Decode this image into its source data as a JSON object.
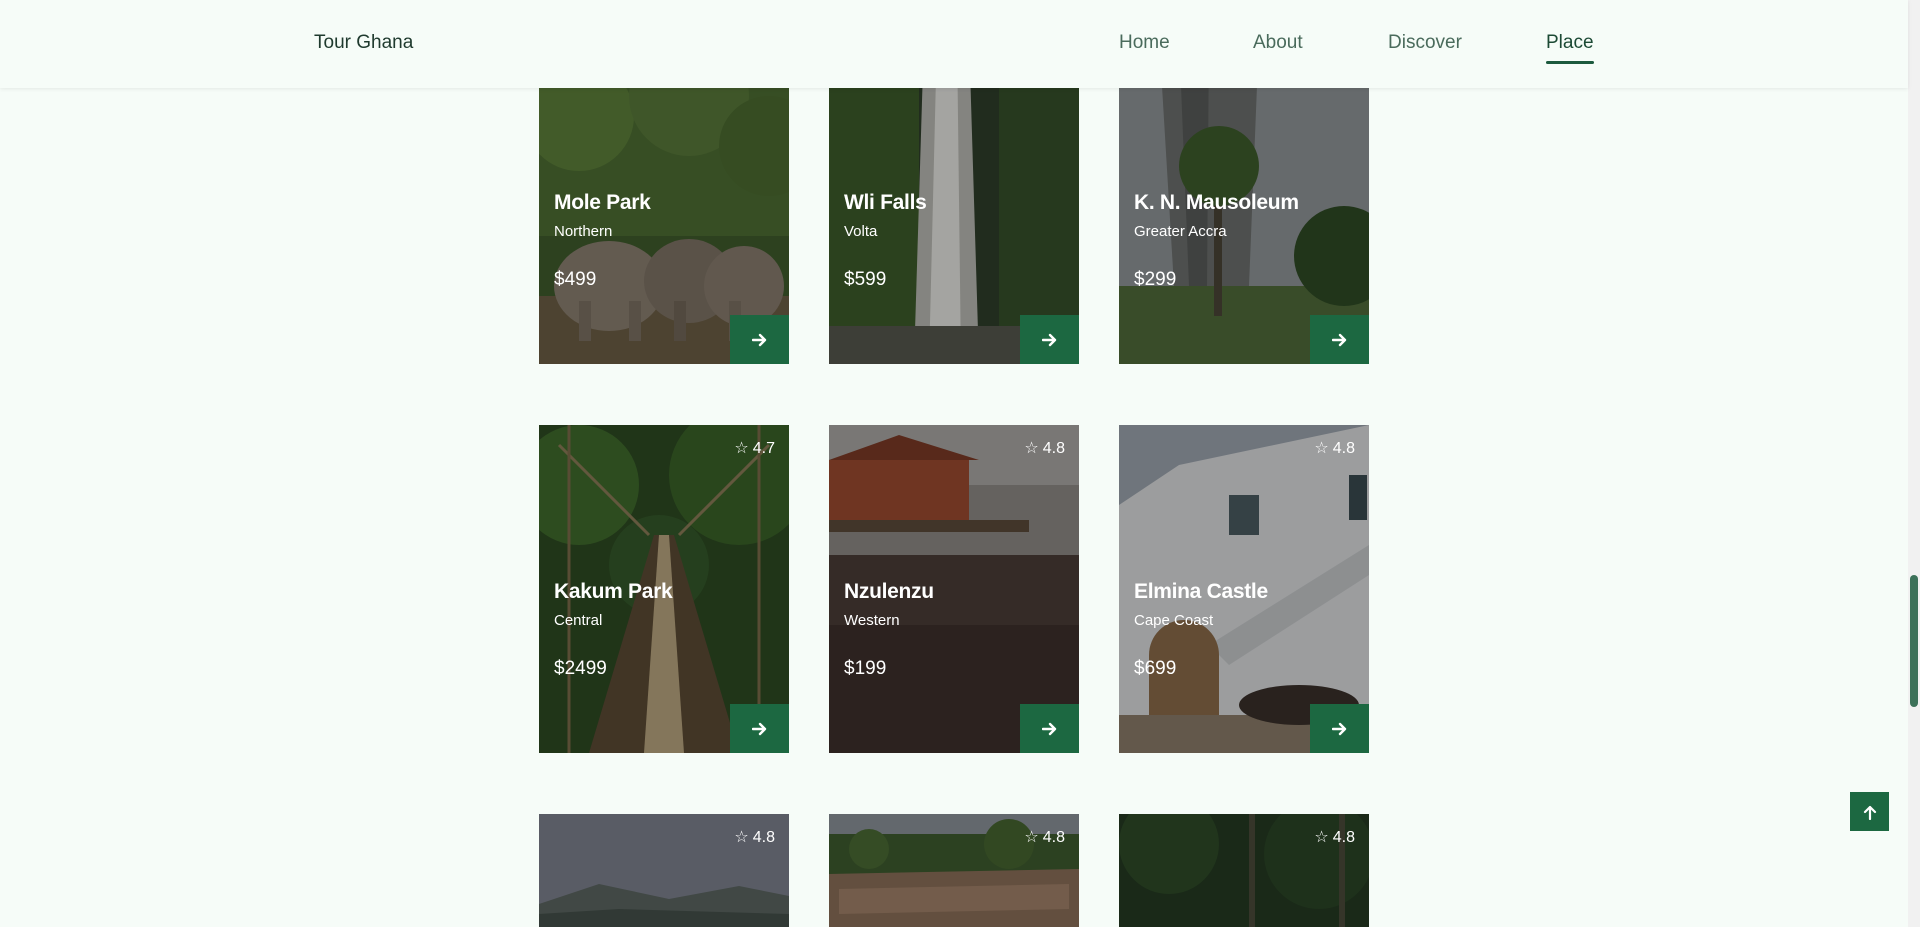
{
  "header": {
    "logo": "Tour Ghana",
    "nav": [
      {
        "label": "Home"
      },
      {
        "label": "About"
      },
      {
        "label": "Discover"
      },
      {
        "label": "Place"
      }
    ],
    "active": "Place"
  },
  "places": [
    {
      "name": "Mole Park",
      "region": "Northern",
      "price": "$499",
      "rating": "",
      "scene": "elephants"
    },
    {
      "name": "Wli Falls",
      "region": "Volta",
      "price": "$599",
      "rating": "",
      "scene": "waterfall"
    },
    {
      "name": "K. N. Mausoleum",
      "region": "Greater Accra",
      "price": "$299",
      "rating": "",
      "scene": "mausoleum"
    },
    {
      "name": "Kakum Park",
      "region": "Central",
      "price": "$2499",
      "rating": "4.7",
      "scene": "canopy"
    },
    {
      "name": "Nzulenzu",
      "region": "Western",
      "price": "$199",
      "rating": "4.8",
      "scene": "stilt-village"
    },
    {
      "name": "Elmina Castle",
      "region": "Cape Coast",
      "price": "$699",
      "rating": "4.8",
      "scene": "castle"
    },
    {
      "name": "",
      "region": "",
      "price": "",
      "rating": "4.8",
      "scene": "mountains"
    },
    {
      "name": "",
      "region": "",
      "price": "",
      "rating": "4.8",
      "scene": "rock-cliff"
    },
    {
      "name": "",
      "region": "",
      "price": "",
      "rating": "4.8",
      "scene": "palms"
    }
  ],
  "colors": {
    "accent": "#1c6841",
    "background": "#f6fcf8",
    "text_dark": "#1f3a2e"
  }
}
